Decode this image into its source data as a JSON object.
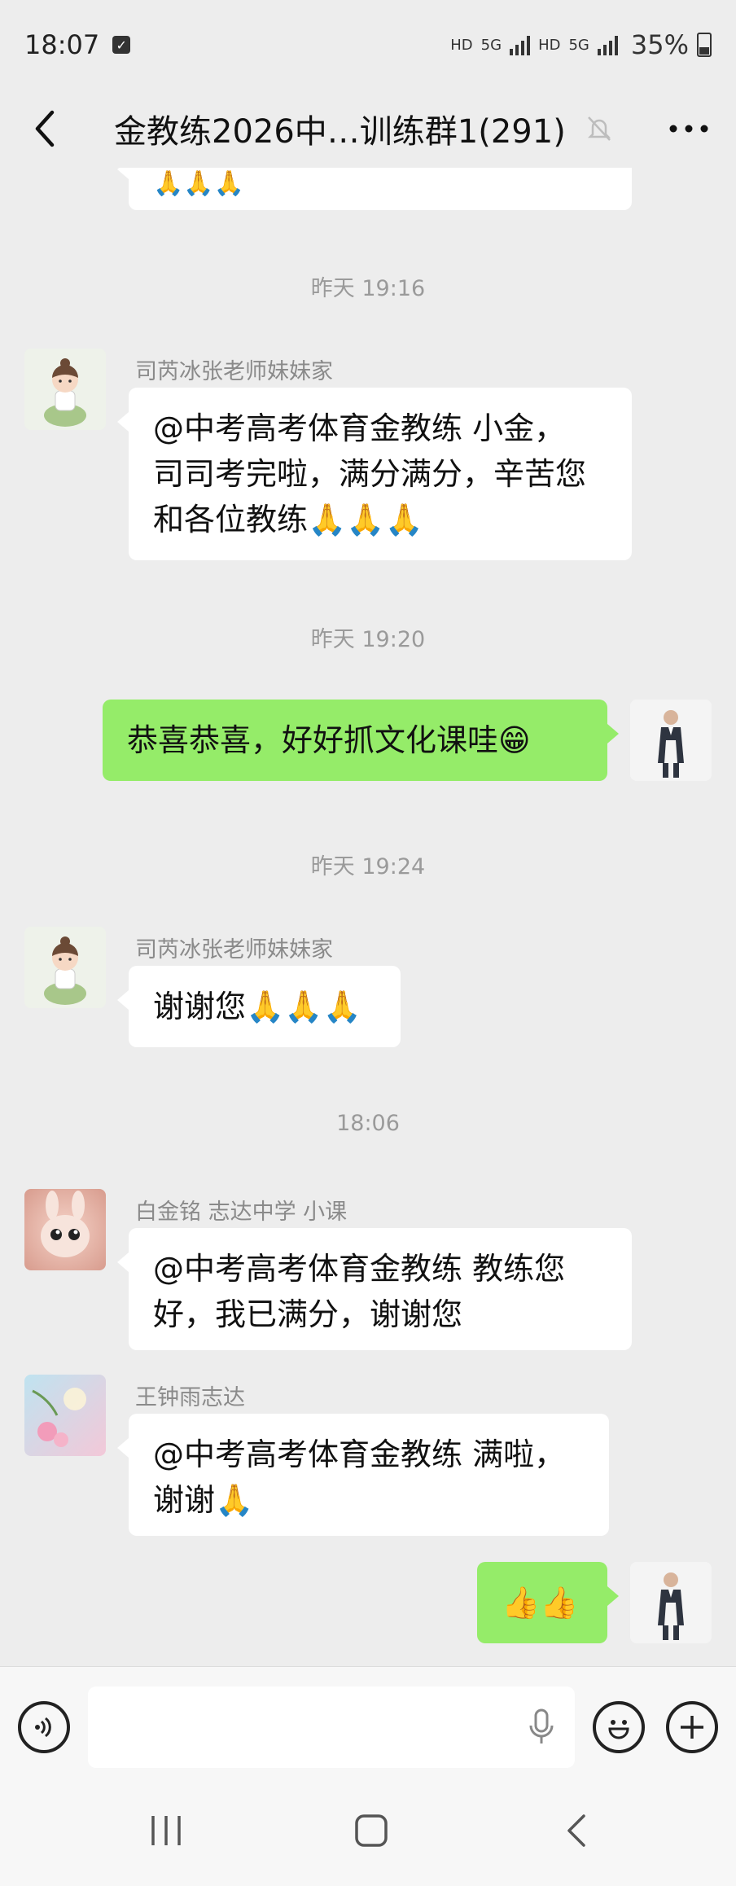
{
  "status_bar": {
    "time": "18:07",
    "hd1": "HD",
    "net1": "5G",
    "hd2": "HD",
    "net2": "5G",
    "battery": "35%"
  },
  "header": {
    "title": "金教练2026中…训练群1(291)"
  },
  "messages": {
    "t1": "昨天 19:16",
    "m1_sender": "司芮冰张老师妹妹家",
    "m1_l1": "@中考高考体育金教练  小金，",
    "m1_l2": "司司考完啦，满分满分，辛苦您",
    "m1_l3": "和各位教练🙏🙏🙏",
    "t2": "昨天 19:20",
    "m2_text": "恭喜恭喜，好好抓文化课哇😁",
    "t3": "昨天 19:24",
    "m3_sender": "司芮冰张老师妹妹家",
    "m3_text": "谢谢您🙏🙏🙏",
    "t4": "18:06",
    "m4_sender": "白金铭 志达中学 小课",
    "m4_l1": "@中考高考体育金教练  教练您",
    "m4_l2": "好，我已满分，谢谢您",
    "m5_sender": "王钟雨志达",
    "m5_l1": "@中考高考体育金教练  满啦，",
    "m5_l2": "谢谢🙏",
    "m6_text": "👍👍",
    "prev_emoji": "🙏🙏🙏"
  },
  "colors": {
    "background": "#ededed",
    "sent_bubble": "#95ec69",
    "received_bubble": "#ffffff"
  }
}
